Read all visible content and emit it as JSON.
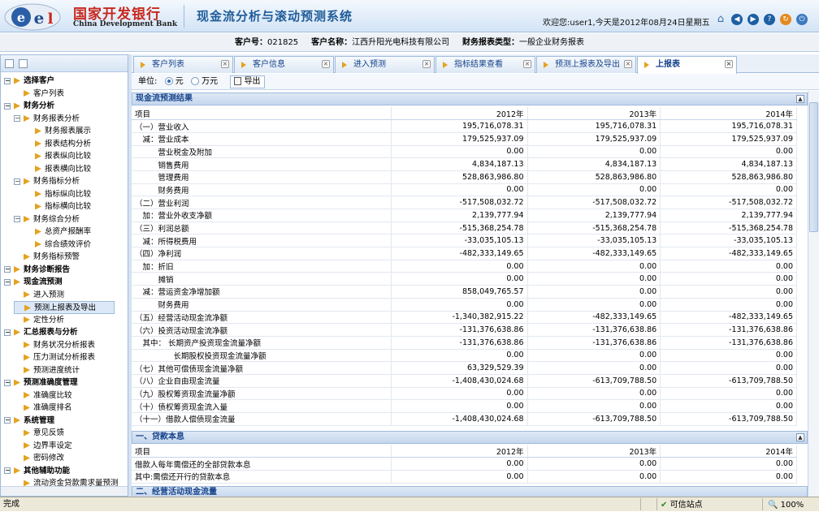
{
  "header": {
    "brand_cn": "国家开发银行",
    "brand_en": "China Development Bank",
    "system_title": "现金流分析与滚动预测系统",
    "welcome": "欢迎您:user1,今天是2012年08月24日星期五",
    "icons": [
      "home-icon",
      "back-icon",
      "forward-icon",
      "help-icon",
      "refresh-icon",
      "exit-icon"
    ]
  },
  "infobar": {
    "customer_no_label": "客户号：",
    "customer_no": "021825",
    "customer_name_label": "客户名称：",
    "customer_name": "江西升阳光电科技有限公司",
    "report_type_label": "财务报表类型：",
    "report_type": "一般企业财务报表"
  },
  "sidebar": {
    "items": [
      {
        "label": "选择客户",
        "level": 0,
        "bold": true
      },
      {
        "label": "客户列表",
        "level": 1
      },
      {
        "label": "财务分析",
        "level": 0,
        "bold": true
      },
      {
        "label": "财务报表分析",
        "level": 1,
        "folder": true
      },
      {
        "label": "财务报表展示",
        "level": 2
      },
      {
        "label": "报表结构分析",
        "level": 2
      },
      {
        "label": "报表纵向比较",
        "level": 2
      },
      {
        "label": "报表横向比较",
        "level": 2
      },
      {
        "label": "财务指标分析",
        "level": 1,
        "folder": true
      },
      {
        "label": "指标纵向比较",
        "level": 2
      },
      {
        "label": "指标横向比较",
        "level": 2
      },
      {
        "label": "财务综合分析",
        "level": 1,
        "folder": true
      },
      {
        "label": "总资产报酬率",
        "level": 2
      },
      {
        "label": "综合绩效评价",
        "level": 2
      },
      {
        "label": "财务指标预警",
        "level": 1
      },
      {
        "label": "财务诊断报告",
        "level": 0,
        "bold": true
      },
      {
        "label": "现金流预测",
        "level": 0,
        "bold": true
      },
      {
        "label": "进入预测",
        "level": 1
      },
      {
        "label": "预测上报表及导出",
        "level": 1,
        "selected": true
      },
      {
        "label": "定性分析",
        "level": 1
      },
      {
        "label": "汇总报表与分析",
        "level": 0,
        "bold": true
      },
      {
        "label": "财务状况分析报表",
        "level": 1
      },
      {
        "label": "压力测试分析报表",
        "level": 1
      },
      {
        "label": "预测进度统计",
        "level": 1
      },
      {
        "label": "预测准确度管理",
        "level": 0,
        "bold": true
      },
      {
        "label": "准确度比较",
        "level": 1
      },
      {
        "label": "准确度排名",
        "level": 1
      },
      {
        "label": "系统管理",
        "level": 0,
        "bold": true
      },
      {
        "label": "意见反馈",
        "level": 1
      },
      {
        "label": "边界率设定",
        "level": 1
      },
      {
        "label": "密码修改",
        "level": 1
      },
      {
        "label": "其他辅助功能",
        "level": 0,
        "bold": true
      },
      {
        "label": "流动资金贷款需求量预测",
        "level": 1
      }
    ]
  },
  "tabs": [
    {
      "label": "客户列表",
      "active": false
    },
    {
      "label": "客户信息",
      "active": false
    },
    {
      "label": "进入预测",
      "active": false
    },
    {
      "label": "指标结果查看",
      "active": false
    },
    {
      "label": "预测上报表及导出",
      "active": false
    },
    {
      "label": "上报表",
      "active": true
    }
  ],
  "toolbar": {
    "unit_label": "单位:",
    "unit_yuan": "元",
    "unit_wanyuan": "万元",
    "export_label": "导出"
  },
  "section1": {
    "title": "现金流预测结果",
    "header": [
      "项目",
      "2012年",
      "2013年",
      "2014年"
    ],
    "rows": [
      [
        "（一）营业收入",
        "195,716,078.31",
        "195,716,078.31",
        "195,716,078.31"
      ],
      [
        "　减：营业成本",
        "179,525,937.09",
        "179,525,937.09",
        "179,525,937.09"
      ],
      [
        "　　　营业税金及附加",
        "0.00",
        "0.00",
        "0.00"
      ],
      [
        "　　　销售费用",
        "4,834,187.13",
        "4,834,187.13",
        "4,834,187.13"
      ],
      [
        "　　　管理费用",
        "528,863,986.80",
        "528,863,986.80",
        "528,863,986.80"
      ],
      [
        "　　　财务费用",
        "0.00",
        "0.00",
        "0.00"
      ],
      [
        "（二）营业利润",
        "-517,508,032.72",
        "-517,508,032.72",
        "-517,508,032.72"
      ],
      [
        "　加：营业外收支净额",
        "2,139,777.94",
        "2,139,777.94",
        "2,139,777.94"
      ],
      [
        "（三）利润总额",
        "-515,368,254.78",
        "-515,368,254.78",
        "-515,368,254.78"
      ],
      [
        "　减：所得税费用",
        "-33,035,105.13",
        "-33,035,105.13",
        "-33,035,105.13"
      ],
      [
        "（四）净利润",
        "-482,333,149.65",
        "-482,333,149.65",
        "-482,333,149.65"
      ],
      [
        "　加：折旧",
        "0.00",
        "0.00",
        "0.00"
      ],
      [
        "　　　摊销",
        "0.00",
        "0.00",
        "0.00"
      ],
      [
        "　减：营运资金净增加额",
        "858,049,765.57",
        "0.00",
        "0.00"
      ],
      [
        "　　　财务费用",
        "0.00",
        "0.00",
        "0.00"
      ],
      [
        "（五）经营活动现金流净额",
        "-1,340,382,915.22",
        "-482,333,149.65",
        "-482,333,149.65"
      ],
      [
        "（六）投资活动现金流净额",
        "-131,376,638.86",
        "-131,376,638.86",
        "-131,376,638.86"
      ],
      [
        "　其中：  长期资产投资现金流量净额",
        "-131,376,638.86",
        "-131,376,638.86",
        "-131,376,638.86"
      ],
      [
        "　　　　　长期股权投资现金流量净额",
        "0.00",
        "0.00",
        "0.00"
      ],
      [
        "（七）其他可偿债现金流量净额",
        "63,329,529.39",
        "0.00",
        "0.00"
      ],
      [
        "（八）企业自由现金流量",
        "-1,408,430,024.68",
        "-613,709,788.50",
        "-613,709,788.50"
      ],
      [
        "（九）股权筹资现金流量净额",
        "0.00",
        "0.00",
        "0.00"
      ],
      [
        "（十）债权筹资现金流入量",
        "0.00",
        "0.00",
        "0.00"
      ],
      [
        "（十一）借款人偿债现金流量",
        "-1,408,430,024.68",
        "-613,709,788.50",
        "-613,709,788.50"
      ]
    ]
  },
  "section2": {
    "title": "一、贷款本息",
    "header": [
      "项目",
      "2012年",
      "2013年",
      "2014年"
    ],
    "rows": [
      [
        "借款人每年需偿还的全部贷款本息",
        "0.00",
        "0.00",
        "0.00"
      ],
      [
        "其中:需偿还开行的贷款本息",
        "0.00",
        "0.00",
        "0.00"
      ]
    ]
  },
  "section3": {
    "title": "二、经营活动现金流量"
  },
  "statusbar": {
    "left": "完成",
    "trusted": "可信站点",
    "zoom": "100%"
  }
}
